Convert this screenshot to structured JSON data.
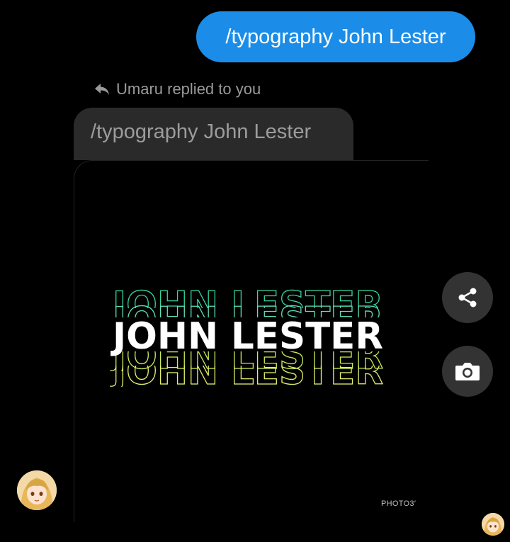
{
  "sent_message": {
    "text": "/typography John Lester"
  },
  "reply_header": {
    "label": "Umaru replied to you",
    "icon": "reply-arrow-icon"
  },
  "quoted_message": {
    "text": "/typography John Lester"
  },
  "image": {
    "main_text": "JOHN LESTER",
    "watermark": "PHOTO3′",
    "colors": {
      "top_echo": "#35d6a0",
      "bottom_echo": "#d4ee4a",
      "main": "#ffffff"
    }
  },
  "actions": {
    "share_icon": "share-icon",
    "camera_icon": "camera-icon"
  },
  "colors": {
    "sent_bubble": "#1b8de8",
    "received_bubble": "#2a2a2a",
    "background": "#000000"
  }
}
